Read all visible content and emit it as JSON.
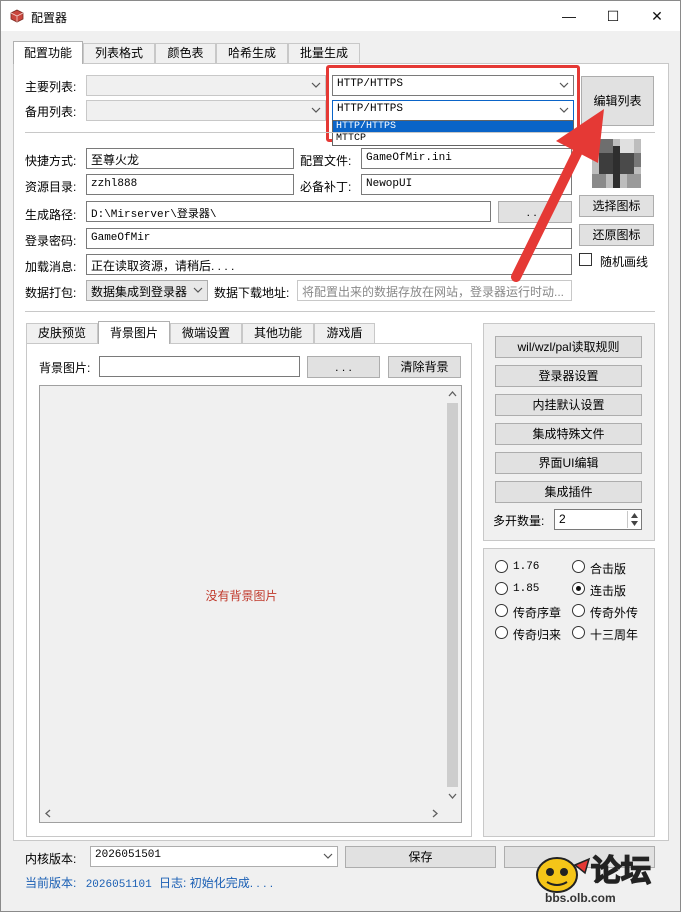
{
  "window": {
    "title": "配置器",
    "minimize": "—",
    "maximize": "☐",
    "close": "✕"
  },
  "top_tabs": [
    "配置功能",
    "列表格式",
    "颜色表",
    "哈希生成",
    "批量生成"
  ],
  "lists": {
    "primary_label": "主要列表:",
    "backup_label": "备用列表:",
    "primary_protocol": "HTTP/HTTPS",
    "backup_protocol": "HTTP/HTTPS",
    "dropdown_options": [
      "HTTP/HTTPS",
      "MTTCP"
    ],
    "edit_button": "编辑列表"
  },
  "form": {
    "shortcut_label": "快捷方式:",
    "shortcut_value": "至尊火龙",
    "config_label": "配置文件:",
    "config_value": "GameOfMir.ini",
    "resource_label": "资源目录:",
    "resource_value": "zzhl888",
    "patch_label": "必备补丁:",
    "patch_value": "NewopUI",
    "output_label": "生成路径:",
    "output_value": "D:\\Mirserver\\登录器\\",
    "browse_button": ". . .",
    "password_label": "登录密码:",
    "password_value": "GameOfMir",
    "loading_label": "加载消息:",
    "loading_value": "正在读取资源，请稍后. . . .",
    "pack_label": "数据打包:",
    "pack_value": "数据集成到登录器",
    "download_label": "数据下载地址:",
    "download_placeholder": "将配置出来的数据存放在网站，登录器运行时动..."
  },
  "icon_buttons": {
    "select": "选择图标",
    "restore": "还原图标",
    "random_label": "随机画线"
  },
  "inner_tabs": [
    "皮肤预览",
    "背景图片",
    "微端设置",
    "其他功能",
    "游戏盾"
  ],
  "background": {
    "label": "背景图片:",
    "browse": ". . .",
    "clear": "清除背景",
    "empty_text": "没有背景图片"
  },
  "right_buttons": [
    "wil/wzl/pal读取规则",
    "登录器设置",
    "内挂默认设置",
    "集成特殊文件",
    "界面UI编辑",
    "集成插件"
  ],
  "multi": {
    "label": "多开数量:",
    "value": "2"
  },
  "versions_radio": [
    {
      "label": "1.76",
      "checked": false
    },
    {
      "label": "合击版",
      "checked": false
    },
    {
      "label": "1.85",
      "checked": false
    },
    {
      "label": "连击版",
      "checked": true
    },
    {
      "label": "传奇序章",
      "checked": false
    },
    {
      "label": "传奇外传",
      "checked": false
    },
    {
      "label": "传奇归来",
      "checked": false
    },
    {
      "label": "十三周年",
      "checked": false
    }
  ],
  "bottom": {
    "kernel_label": "内核版本:",
    "kernel_value": "2026051501",
    "save_button": "保存",
    "current_label": "当前版本:",
    "current_value": "2026051101",
    "log_label": "日志:",
    "log_value": "初始化完成. . . ."
  },
  "watermark": {
    "brand": "论坛",
    "url": "bbs.olb.com"
  },
  "colors": {
    "accent_red": "#e53935",
    "selection_blue": "#0a64c8",
    "warning_red": "#c0392b",
    "status_blue": "#1a5fb4"
  }
}
